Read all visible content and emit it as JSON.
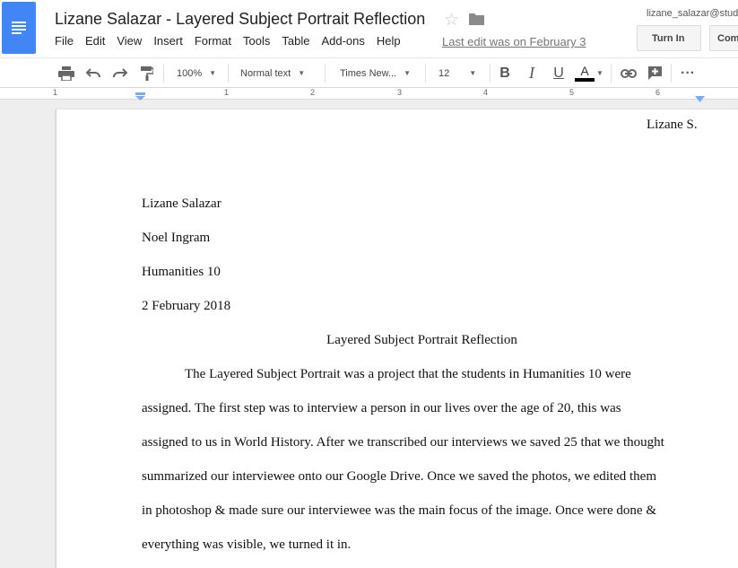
{
  "header": {
    "title": "Lizane Salazar - Layered Subject Portrait Reflection",
    "last_edit": "Last edit was on February 3",
    "user_email": "lizane_salazar@stud",
    "turn_in_label": "Turn In",
    "comments_label": "Com",
    "menu": [
      "File",
      "Edit",
      "View",
      "Insert",
      "Format",
      "Tools",
      "Table",
      "Add-ons",
      "Help"
    ]
  },
  "toolbar": {
    "zoom": "100%",
    "style": "Normal text",
    "font": "Times New...",
    "size": "12",
    "bold": "B",
    "italic": "I",
    "underline": "U",
    "text_color": "A",
    "more": "···"
  },
  "ruler": {
    "numbers": [
      "1",
      "1",
      "2",
      "3",
      "4",
      "5",
      "6"
    ]
  },
  "document": {
    "header_name": "Lizane S.",
    "lines": [
      "Lizane Salazar",
      "Noel Ingram",
      "Humanities 10",
      "2 February 2018"
    ],
    "title": "Layered Subject Portrait Reflection",
    "paragraph_lines": [
      "The Layered Subject Portrait was a project that the students in Humanities 10 were",
      "assigned. The first step was to interview a person in our lives over the age of 20, this was",
      "assigned to us in World History. After we transcribed our interviews we saved 25 that we thought",
      "summarized our interviewee onto our Google Drive. Once we saved the photos, we edited them",
      "in photoshop & made sure our interviewee was the main focus of the image. Once were done &",
      "everything was visible, we turned it in."
    ]
  },
  "colors": {
    "docs_blue": "#4285f4",
    "text_color_bar": "#000000"
  },
  "icons": [
    "docs-logo-icon",
    "star-icon",
    "folder-icon",
    "print-icon",
    "undo-icon",
    "redo-icon",
    "paint-format-icon",
    "link-icon",
    "add-comment-icon"
  ]
}
